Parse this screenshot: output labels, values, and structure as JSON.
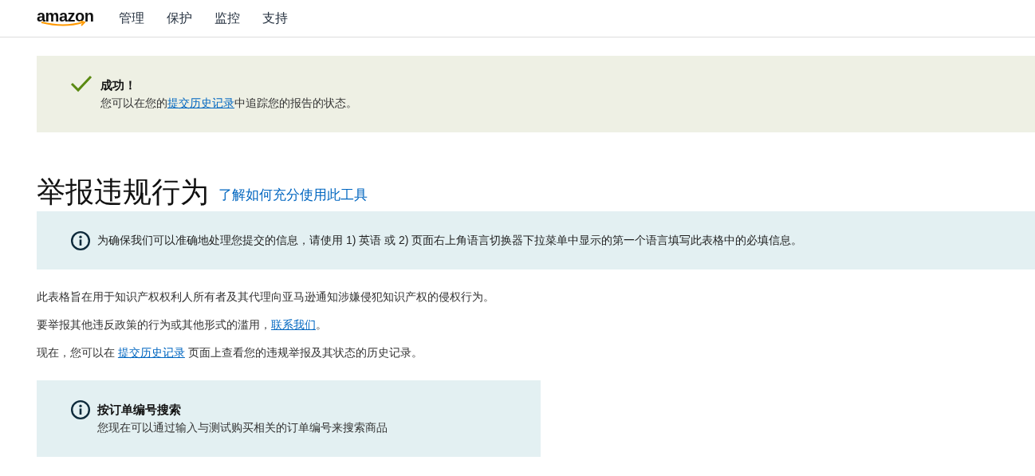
{
  "header": {
    "logo": "amazon",
    "nav": [
      {
        "label": "管理"
      },
      {
        "label": "保护"
      },
      {
        "label": "监控"
      },
      {
        "label": "支持"
      }
    ]
  },
  "success": {
    "title": "成功！",
    "message": [
      {
        "kind": "text",
        "text": "您可以在您的"
      },
      {
        "kind": "link",
        "text": "提交历史记录"
      },
      {
        "kind": "text",
        "text": "中追踪您的报告的状态。"
      }
    ]
  },
  "page_title": "举报违规行为",
  "help_link": "了解如何充分使用此工具",
  "language_notice": "为确保我们可以准确地处理您提交的信息，请使用 1) 英语 或 2) 页面右上角语言切换器下拉菜单中显示的第一个语言填写此表格中的必填信息。",
  "paragraphs": [
    [
      {
        "kind": "text",
        "text": "此表格旨在用于知识产权权利人所有者及其代理向亚马逊通知涉嫌侵犯知识产权的侵权行为。"
      }
    ],
    [
      {
        "kind": "text",
        "text": "要举报其他违反政策的行为或其他形式的滥用，"
      },
      {
        "kind": "link",
        "text": "联系我们"
      },
      {
        "kind": "text",
        "text": "。"
      }
    ],
    [
      {
        "kind": "text",
        "text": "现在，您可以在 "
      },
      {
        "kind": "link",
        "text": "提交历史记录"
      },
      {
        "kind": "text",
        "text": " 页面上查看您的违规举报及其状态的历史记录。"
      }
    ]
  ],
  "order_search": {
    "title": "按订单编号搜索",
    "message": "您现在可以通过输入与测试购买相关的订单编号来搜索商品"
  }
}
